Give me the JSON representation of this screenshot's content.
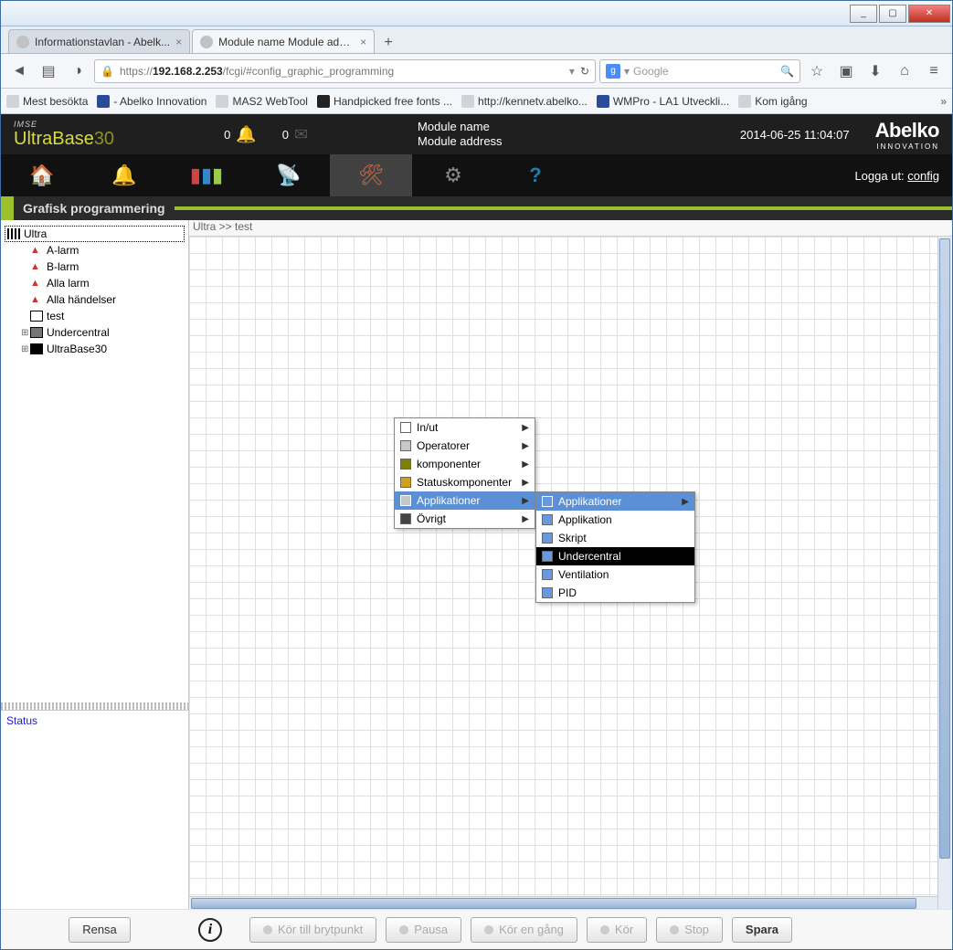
{
  "window": {
    "min": "_",
    "max": "▢",
    "close": "✕"
  },
  "tabs": [
    {
      "label": "Informationstavlan - Abelk...",
      "closable": true
    },
    {
      "label": "Module name Module address ...",
      "closable": true
    }
  ],
  "url": {
    "host": "192.168.2.253",
    "rest": "/fcgi/#config_graphic_programming",
    "scheme": "https://"
  },
  "search": {
    "provider": "g",
    "placeholder": "Google"
  },
  "nav_icons": {
    "back": "◄",
    "sidebar": "▤",
    "shield": "◑",
    "star": "☆",
    "clip": "▣",
    "down": "⬇",
    "home": "⌂",
    "menu": "≡"
  },
  "bookmarks": [
    {
      "label": "Mest besökta"
    },
    {
      "label": "- Abelko Innovation"
    },
    {
      "label": "MAS2 WebTool"
    },
    {
      "label": "Handpicked free fonts ..."
    },
    {
      "label": "http://kennetv.abelko..."
    },
    {
      "label": "WMPro - LA1 Utveckli..."
    },
    {
      "label": "Kom igång"
    }
  ],
  "bookmarks_more": "»",
  "header": {
    "imse": "IMSE",
    "product": "UltraBase",
    "product_suffix": "30",
    "badge1": "0",
    "badge2": "0",
    "module_name": "Module name",
    "module_address": "Module address",
    "datetime": "2014-06-25 11:04:07",
    "brand": "Abelko",
    "brand_sub": "INNOVATION",
    "logout_label": "Logga ut:",
    "logout_user": "config"
  },
  "mainmenu_icons": {
    "home": "🏠",
    "bell": "🔔",
    "chart": "▮▮▮",
    "antenna": "📡",
    "tool": "✎",
    "gear": "⚙",
    "help": "?"
  },
  "section_title": "Grafisk programmering",
  "tree": [
    {
      "icon": "striped",
      "label": "Ultra",
      "indent": 0,
      "selected": true
    },
    {
      "icon": "bell",
      "label": "A-larm",
      "indent": 1
    },
    {
      "icon": "bell",
      "label": "B-larm",
      "indent": 1
    },
    {
      "icon": "bell",
      "label": "Alla larm",
      "indent": 1
    },
    {
      "icon": "bell",
      "label": "Alla händelser",
      "indent": 1
    },
    {
      "icon": "sq",
      "label": "test",
      "indent": 1
    },
    {
      "icon": "sq-grey",
      "label": "Undercentral",
      "indent": 1,
      "expander": "⊕"
    },
    {
      "icon": "sq-black",
      "label": "UltraBase30",
      "indent": 1,
      "expander": "⊕"
    }
  ],
  "status_label": "Status",
  "breadcrumb": "Ultra >> test",
  "ctx1": [
    {
      "label": "In/ut",
      "color": "cwhite",
      "arrow": true
    },
    {
      "label": "Operatorer",
      "color": "cgrey",
      "arrow": true
    },
    {
      "label": "komponenter",
      "color": "colive",
      "arrow": true
    },
    {
      "label": "Statuskomponenter",
      "color": "cgold",
      "arrow": true
    },
    {
      "label": "Applikationer",
      "color": "cgrey",
      "arrow": true,
      "highlight": true
    },
    {
      "label": "Övrigt",
      "color": "cdark",
      "arrow": true
    }
  ],
  "ctx2": [
    {
      "label": "Applikationer",
      "color": "cblue",
      "arrow": true,
      "highlight": true
    },
    {
      "label": "Applikation",
      "color": "cblue"
    },
    {
      "label": "Skript",
      "color": "cblue"
    },
    {
      "label": "Undercentral",
      "color": "cblue",
      "dark": true
    },
    {
      "label": "Ventilation",
      "color": "cblue"
    },
    {
      "label": "PID",
      "color": "cblue"
    }
  ],
  "toolbar": {
    "clear": "Rensa",
    "info": "i",
    "run_breakpoint": "Kör till brytpunkt",
    "pause": "Pausa",
    "run_once": "Kör en gång",
    "run": "Kör",
    "stop": "Stop",
    "save": "Spara"
  }
}
